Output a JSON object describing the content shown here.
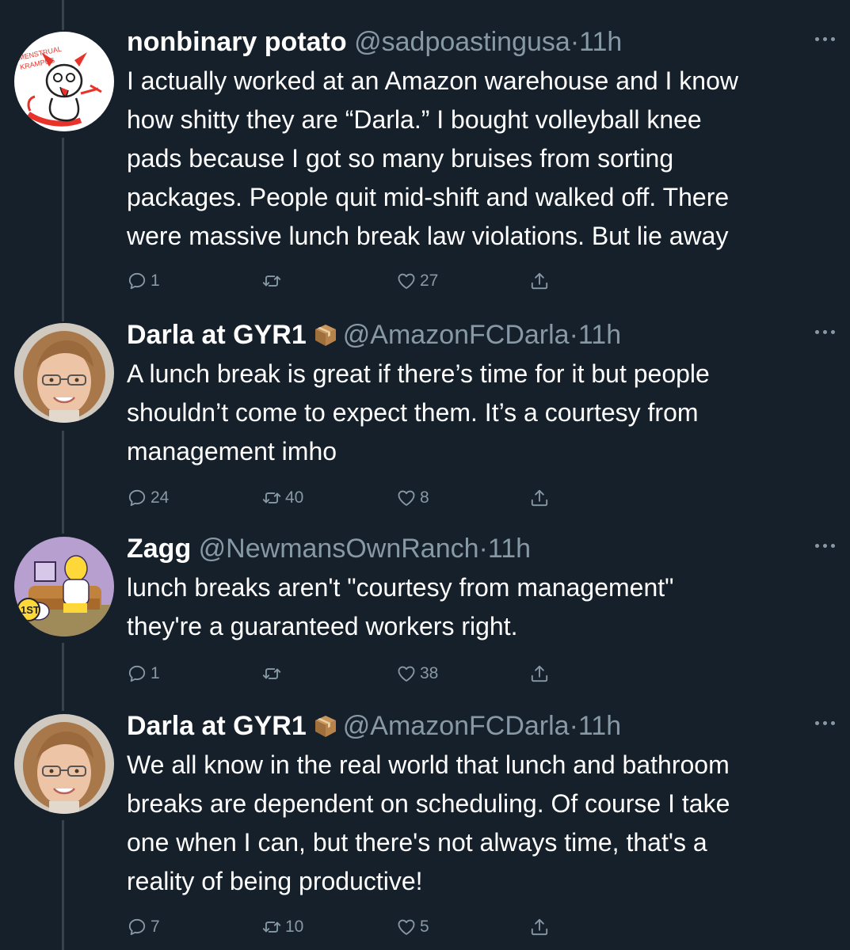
{
  "tweets": [
    {
      "name": "nonbinary potato",
      "handle": "@sadpoastingusa",
      "sep": "·",
      "time": "11h",
      "body": "I actually worked at an Amazon warehouse and I know\nhow shitty they are “Darla.” I bought volleyball knee\npads because I got so many bruises from sorting\npackages. People quit mid-shift and walked off. There\nwere massive lunch break law violations. But lie away",
      "replies": "1",
      "retweets": "",
      "likes": "27",
      "avatar_text_1": "MENSTRUAL",
      "avatar_text_2": "KRAMPUS"
    },
    {
      "name": "Darla at GYR1",
      "handle": "@AmazonFCDarla",
      "sep": "·",
      "time": "11h",
      "body": "A lunch break is great if there’s time for it but people\nshouldn’t come to expect them. It’s a courtesy from\nmanagement imho",
      "replies": "24",
      "retweets": "40",
      "likes": "8"
    },
    {
      "name": "Zagg",
      "handle": "@NewmansOwnRanch",
      "sep": "·",
      "time": "11h",
      "body": "lunch breaks aren't \"courtesy from management\"\nthey're a guaranteed workers right.",
      "replies": "1",
      "retweets": "",
      "likes": "38",
      "avatar_text_1": "1ST"
    },
    {
      "name": "Darla at GYR1",
      "handle": "@AmazonFCDarla",
      "sep": "·",
      "time": "11h",
      "body": "We all know in the real world that lunch and bathroom\nbreaks are dependent on scheduling. Of course I take\none when I can, but there's not always time, that's a\nreality of being productive!",
      "replies": "7",
      "retweets": "10",
      "likes": "5"
    }
  ],
  "colors": {
    "background": "#15202b",
    "text": "#ffffff",
    "secondary": "#8899a6",
    "thread_line": "#38444d"
  },
  "icons": {
    "reply": "speech-bubble-icon",
    "retweet": "retweet-icon",
    "like": "heart-icon",
    "share": "share-upload-icon",
    "more": "more-dots-icon",
    "box": "package-box-emoji"
  }
}
